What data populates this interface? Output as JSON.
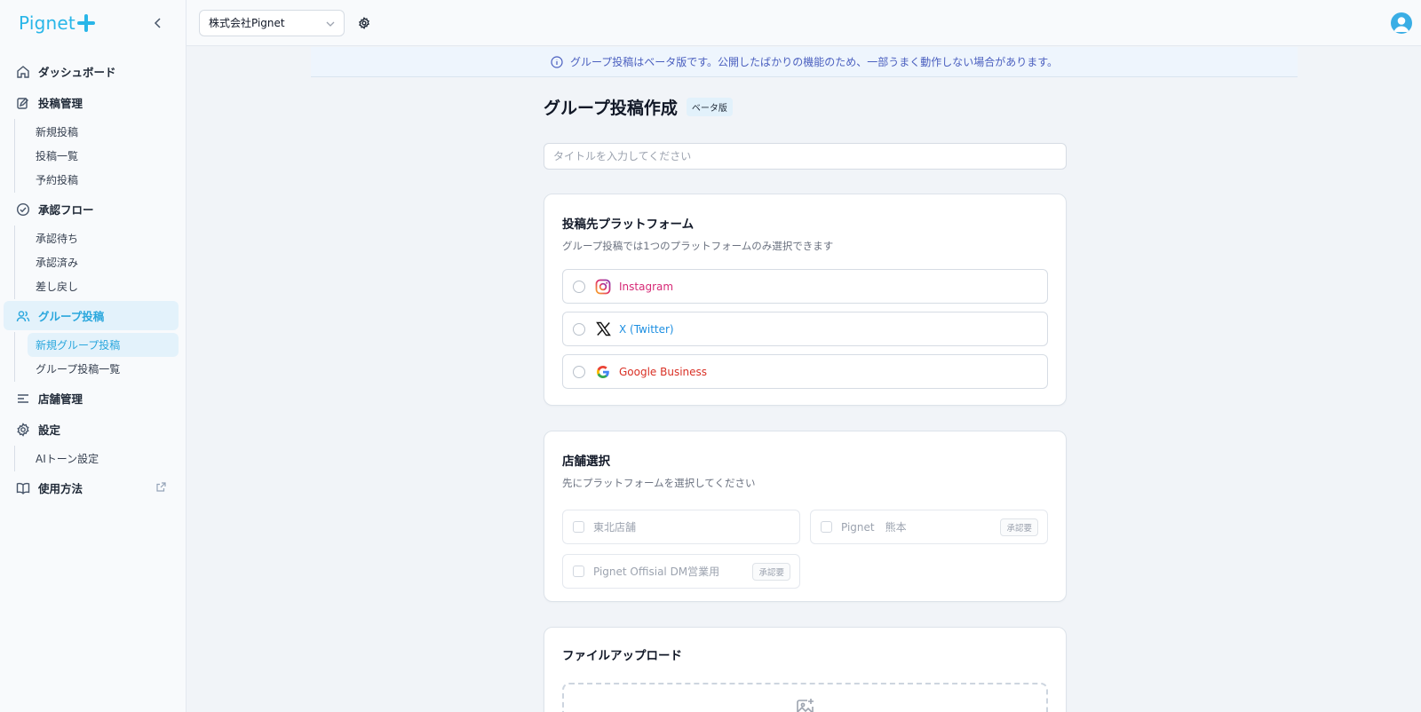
{
  "app": {
    "logo_text": "Pignet",
    "brand_color": "#29b6e8"
  },
  "sidebar": {
    "nav": [
      {
        "label": "ダッシュボード",
        "icon": "home-icon"
      },
      {
        "label": "投稿管理",
        "icon": "edit-post-icon",
        "children": [
          "新規投稿",
          "投稿一覧",
          "予約投稿"
        ]
      },
      {
        "label": "承認フロー",
        "icon": "check-circle-icon",
        "children": [
          "承認待ち",
          "承認済み",
          "差し戻し"
        ]
      },
      {
        "label": "グループ投稿",
        "icon": "users-icon",
        "active": true,
        "children": [
          "新規グループ投稿",
          "グループ投稿一覧"
        ],
        "active_child": "新規グループ投稿"
      },
      {
        "label": "店舗管理",
        "icon": "list-icon"
      },
      {
        "label": "設定",
        "icon": "gear-icon",
        "children": [
          "AIトーン設定"
        ]
      },
      {
        "label": "使用方法",
        "icon": "book-icon",
        "external": true
      }
    ]
  },
  "topbar": {
    "company_select": "株式会社Pignet"
  },
  "notice": {
    "text": "グループ投稿はベータ版です。公開したばかりの機能のため、一部うまく動作しない場合があります。"
  },
  "page": {
    "title": "グループ投稿作成",
    "beta_badge": "ベータ版",
    "title_placeholder": "タイトルを入力してください"
  },
  "platform_section": {
    "heading": "投稿先プラットフォーム",
    "description": "グループ投稿では1つのプラットフォームのみ選択できます",
    "options": [
      {
        "label": "Instagram",
        "color": "#d62976",
        "icon": "instagram-icon"
      },
      {
        "label": "X (Twitter)",
        "color": "#1d8fe1",
        "icon": "x-logo-icon"
      },
      {
        "label": "Google Business",
        "color": "#d93025",
        "icon": "google-icon"
      }
    ]
  },
  "store_section": {
    "heading": "店舗選択",
    "description": "先にプラットフォームを選択してください",
    "stores": [
      {
        "name": "東北店舗",
        "badge": ""
      },
      {
        "name": "Pignet　熊本",
        "badge": "承認要"
      },
      {
        "name": "Pignet Offisial DM営業用",
        "badge": "承認要"
      }
    ]
  },
  "file_section": {
    "heading": "ファイルアップロード"
  }
}
